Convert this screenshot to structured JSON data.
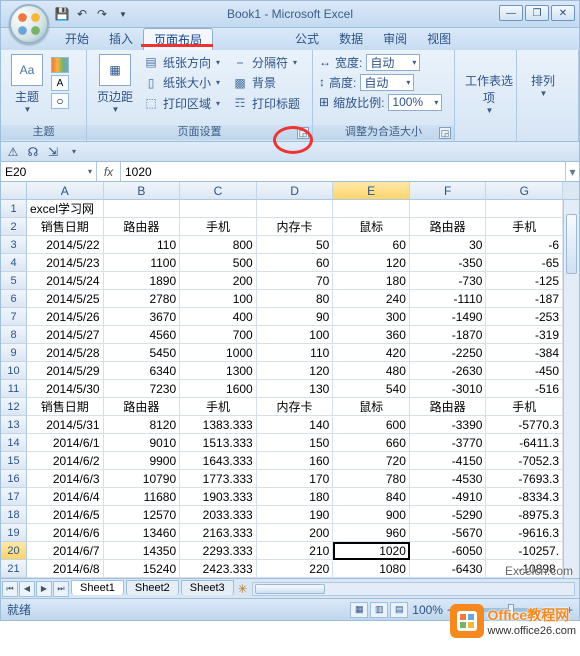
{
  "title": "Book1 - Microsoft Excel",
  "tabs": [
    "开始",
    "插入",
    "页面布局",
    "公式",
    "数据",
    "审阅",
    "视图"
  ],
  "active_tab": 2,
  "ribbon": {
    "themes": {
      "label": "主题",
      "btn": "主题"
    },
    "page_setup": {
      "label": "页面设置",
      "margins": "页边距",
      "orientation": "纸张方向",
      "size": "纸张大小",
      "print_area": "打印区域",
      "breaks": "分隔符",
      "background": "背景",
      "print_titles": "打印标题"
    },
    "scale": {
      "label": "调整为合适大小",
      "width_l": "宽度:",
      "width_v": "自动",
      "height_l": "高度:",
      "height_v": "自动",
      "scale_l": "缩放比例:",
      "scale_v": "100%"
    },
    "sheet_opts": {
      "label": "工作表选项"
    },
    "arrange": {
      "label": "排列"
    }
  },
  "namebox": "E20",
  "formula": "1020",
  "columns": [
    "A",
    "B",
    "C",
    "D",
    "E",
    "F",
    "G"
  ],
  "sel_col": 4,
  "sel_row": 20,
  "data_rows": [
    {
      "n": 1,
      "cells": [
        "excel学习网",
        "",
        "",
        "",
        "",
        "",
        ""
      ],
      "align": [
        "l",
        "l",
        "l",
        "l",
        "l",
        "l",
        "l"
      ]
    },
    {
      "n": 2,
      "cells": [
        "销售日期",
        "路由器",
        "手机",
        "内存卡",
        "鼠标",
        "路由器",
        "手机"
      ],
      "align": [
        "c",
        "c",
        "c",
        "c",
        "c",
        "c",
        "c"
      ]
    },
    {
      "n": 3,
      "cells": [
        "2014/5/22",
        "110",
        "800",
        "50",
        "60",
        "30",
        "-6"
      ]
    },
    {
      "n": 4,
      "cells": [
        "2014/5/23",
        "1100",
        "500",
        "60",
        "120",
        "-350",
        "-65"
      ]
    },
    {
      "n": 5,
      "cells": [
        "2014/5/24",
        "1890",
        "200",
        "70",
        "180",
        "-730",
        "-125"
      ]
    },
    {
      "n": 6,
      "cells": [
        "2014/5/25",
        "2780",
        "100",
        "80",
        "240",
        "-1110",
        "-187"
      ]
    },
    {
      "n": 7,
      "cells": [
        "2014/5/26",
        "3670",
        "400",
        "90",
        "300",
        "-1490",
        "-253"
      ]
    },
    {
      "n": 8,
      "cells": [
        "2014/5/27",
        "4560",
        "700",
        "100",
        "360",
        "-1870",
        "-319"
      ]
    },
    {
      "n": 9,
      "cells": [
        "2014/5/28",
        "5450",
        "1000",
        "110",
        "420",
        "-2250",
        "-384"
      ]
    },
    {
      "n": 10,
      "cells": [
        "2014/5/29",
        "6340",
        "1300",
        "120",
        "480",
        "-2630",
        "-450"
      ]
    },
    {
      "n": 11,
      "cells": [
        "2014/5/30",
        "7230",
        "1600",
        "130",
        "540",
        "-3010",
        "-516"
      ]
    },
    {
      "n": 12,
      "cells": [
        "销售日期",
        "路由器",
        "手机",
        "内存卡",
        "鼠标",
        "路由器",
        "手机"
      ],
      "align": [
        "c",
        "c",
        "c",
        "c",
        "c",
        "c",
        "c"
      ]
    },
    {
      "n": 13,
      "cells": [
        "2014/5/31",
        "8120",
        "1383.333",
        "140",
        "600",
        "-3390",
        "-5770.3"
      ]
    },
    {
      "n": 14,
      "cells": [
        "2014/6/1",
        "9010",
        "1513.333",
        "150",
        "660",
        "-3770",
        "-6411.3"
      ]
    },
    {
      "n": 15,
      "cells": [
        "2014/6/2",
        "9900",
        "1643.333",
        "160",
        "720",
        "-4150",
        "-7052.3"
      ]
    },
    {
      "n": 16,
      "cells": [
        "2014/6/3",
        "10790",
        "1773.333",
        "170",
        "780",
        "-4530",
        "-7693.3"
      ]
    },
    {
      "n": 17,
      "cells": [
        "2014/6/4",
        "11680",
        "1903.333",
        "180",
        "840",
        "-4910",
        "-8334.3"
      ]
    },
    {
      "n": 18,
      "cells": [
        "2014/6/5",
        "12570",
        "2033.333",
        "190",
        "900",
        "-5290",
        "-8975.3"
      ]
    },
    {
      "n": 19,
      "cells": [
        "2014/6/6",
        "13460",
        "2163.333",
        "200",
        "960",
        "-5670",
        "-9616.3"
      ]
    },
    {
      "n": 20,
      "cells": [
        "2014/6/7",
        "14350",
        "2293.333",
        "210",
        "1020",
        "-6050",
        "-10257."
      ]
    },
    {
      "n": 21,
      "cells": [
        "2014/6/8",
        "15240",
        "2423.333",
        "220",
        "1080",
        "-6430",
        "-10898."
      ]
    }
  ],
  "sheets": [
    "Sheet1",
    "Sheet2",
    "Sheet3"
  ],
  "active_sheet": 0,
  "status": {
    "ready": "就绪",
    "zoom": "100%"
  },
  "watermark": {
    "brand": "Office教程网",
    "url": "www.office26.com"
  },
  "watermark2": "Excelcn.com"
}
